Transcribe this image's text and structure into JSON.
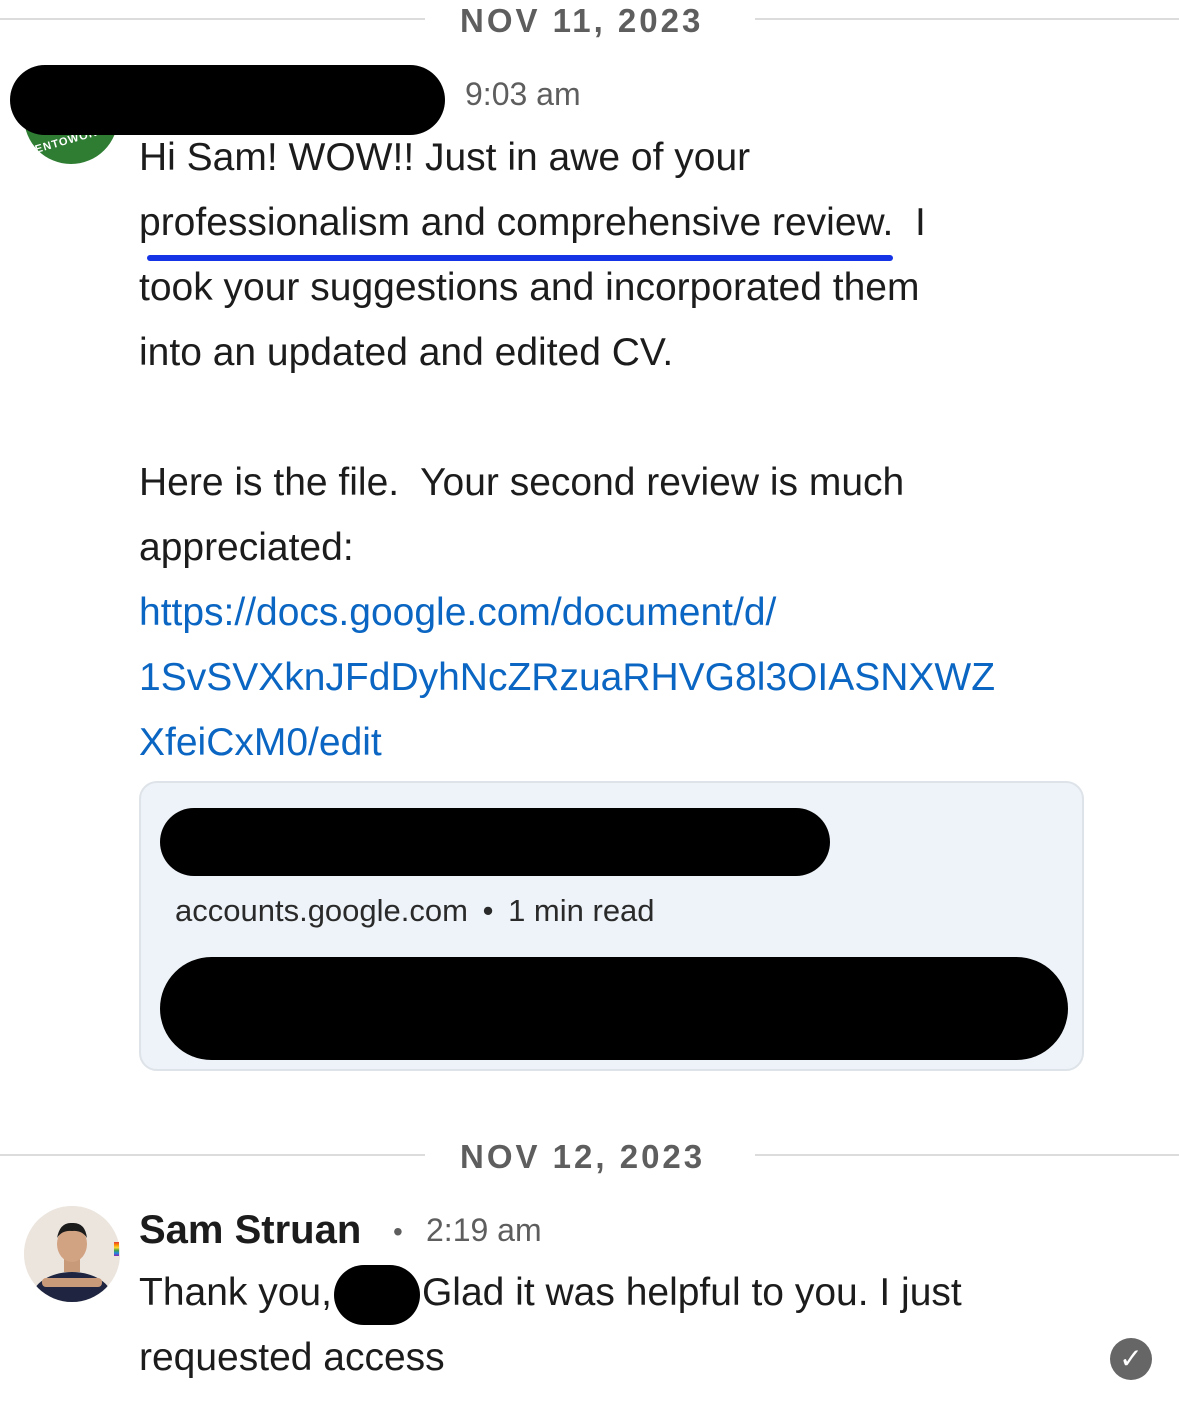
{
  "separators": [
    {
      "date": "NOV 11, 2023"
    },
    {
      "date": "NOV 12, 2023"
    }
  ],
  "message1": {
    "time": "9:03 am",
    "line1": "Hi Sam!  WOW!!  Just in awe of your",
    "line2_highlight": "professionalism and comprehensive review.",
    "line2_rest": "  I",
    "line3": "took your suggestions and incorporated them",
    "line4": "into an updated and edited CV.",
    "para2_line1": "Here is the file.  Your second review is much",
    "para2_line2": "appreciated:",
    "link_line1": "https://docs.google.com/document/d/",
    "link_line2": "1SvSVXknJFdDyhNcZRzuaRHVG8l3OIASNXWZ",
    "link_line3": "XfeiCxM0/edit",
    "preview": {
      "domain": "accounts.google.com",
      "separator": "•",
      "read_time": "1 min read"
    },
    "avatar_badge": "ENTOWORK"
  },
  "message2": {
    "sender": "Sam Struan",
    "separator": "•",
    "time": "2:19 am",
    "text_before": "Thank you,",
    "text_after": "Glad it was helpful to you. I just",
    "line2": "requested access",
    "status_icon": "check-circle-icon"
  },
  "colors": {
    "link": "#0a66c2",
    "highlight_underline": "#1434e6",
    "card_background": "#edf3f8",
    "avatar_green": "#2e7d32"
  }
}
